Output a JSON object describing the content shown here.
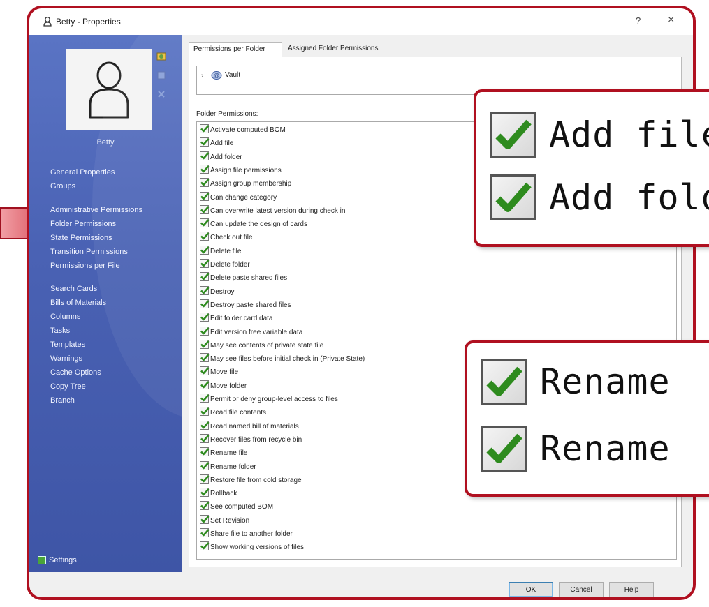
{
  "window": {
    "title": "Betty - Properties",
    "help_glyph": "?",
    "close_glyph": "×"
  },
  "sidebar": {
    "user_name": "Betty",
    "nav": [
      {
        "label": "General Properties"
      },
      {
        "label": "Groups"
      },
      {
        "label": "Administrative Permissions"
      },
      {
        "label": "Folder Permissions",
        "selected": true
      },
      {
        "label": "State Permissions"
      },
      {
        "label": "Transition Permissions"
      },
      {
        "label": "Permissions per File"
      },
      {
        "label": "Search Cards"
      },
      {
        "label": "Bills of Materials"
      },
      {
        "label": "Columns"
      },
      {
        "label": "Tasks"
      },
      {
        "label": "Templates"
      },
      {
        "label": "Warnings"
      },
      {
        "label": "Cache Options"
      },
      {
        "label": "Copy Tree"
      },
      {
        "label": "Branch"
      }
    ],
    "settings_label": "Settings"
  },
  "tabs": [
    {
      "label": "Permissions per Folder",
      "active": true
    },
    {
      "label": "Assigned Folder Permissions",
      "active": false
    }
  ],
  "tree": {
    "root_label": "Vault"
  },
  "folder_permissions_label": "Folder Permissions:",
  "permissions": [
    {
      "label": "Activate computed BOM",
      "checked": true
    },
    {
      "label": "Add file",
      "checked": true
    },
    {
      "label": "Add folder",
      "checked": true
    },
    {
      "label": "Assign file permissions",
      "checked": true
    },
    {
      "label": "Assign group membership",
      "checked": true
    },
    {
      "label": "Can change category",
      "checked": true
    },
    {
      "label": "Can overwrite latest version during check in",
      "checked": true
    },
    {
      "label": "Can update the design of cards",
      "checked": true
    },
    {
      "label": "Check out file",
      "checked": true
    },
    {
      "label": "Delete file",
      "checked": true
    },
    {
      "label": "Delete folder",
      "checked": true
    },
    {
      "label": "Delete paste shared files",
      "checked": true
    },
    {
      "label": "Destroy",
      "checked": true
    },
    {
      "label": "Destroy paste shared files",
      "checked": true
    },
    {
      "label": "Edit folder card data",
      "checked": true
    },
    {
      "label": "Edit version free variable data",
      "checked": true
    },
    {
      "label": "May see contents of private state file",
      "checked": true
    },
    {
      "label": "May see files before initial check in (Private State)",
      "checked": true
    },
    {
      "label": "Move file",
      "checked": true
    },
    {
      "label": "Move folder",
      "checked": true
    },
    {
      "label": "Permit or deny group-level access to files",
      "checked": true
    },
    {
      "label": "Read file contents",
      "checked": true
    },
    {
      "label": "Read named bill of materials",
      "checked": true
    },
    {
      "label": "Recover files from recycle bin",
      "checked": true
    },
    {
      "label": "Rename file",
      "checked": true
    },
    {
      "label": "Rename folder",
      "checked": true
    },
    {
      "label": "Restore file from cold storage",
      "checked": true
    },
    {
      "label": "Rollback",
      "checked": true
    },
    {
      "label": "See computed BOM",
      "checked": true
    },
    {
      "label": "Set Revision",
      "checked": true
    },
    {
      "label": "Share file to another folder",
      "checked": true
    },
    {
      "label": "Show working versions of files",
      "checked": true
    }
  ],
  "buttons": {
    "ok": "OK",
    "cancel": "Cancel",
    "help": "Help"
  },
  "callouts": [
    {
      "rows": [
        "Add file",
        "Add fold"
      ]
    },
    {
      "rows": [
        "Rename",
        "Rename"
      ]
    }
  ],
  "colors": {
    "highlight_border": "#b01020",
    "sidebar": "#4a62b4",
    "check": "#2e8b1e"
  }
}
